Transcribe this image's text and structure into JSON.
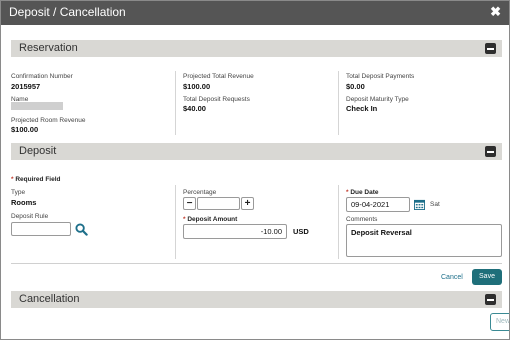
{
  "window": {
    "title": "Deposit / Cancellation",
    "close_glyph": "✖"
  },
  "reservation": {
    "section_title": "Reservation",
    "confirmation_number_label": "Confirmation Number",
    "confirmation_number": "2015957",
    "name_label": "Name",
    "projected_room_revenue_label": "Projected Room Revenue",
    "projected_room_revenue": "$100.00",
    "projected_total_revenue_label": "Projected Total Revenue",
    "projected_total_revenue": "$100.00",
    "total_deposit_requests_label": "Total Deposit Requests",
    "total_deposit_requests": "$40.00",
    "total_deposit_payments_label": "Total Deposit Payments",
    "total_deposit_payments": "$0.00",
    "deposit_maturity_type_label": "Deposit Maturity Type",
    "deposit_maturity_type": "Check In"
  },
  "deposit": {
    "section_title": "Deposit",
    "required_field_label": "Required Field",
    "type_label": "Type",
    "type_value": "Rooms",
    "deposit_rule_label": "Deposit Rule",
    "deposit_rule_value": "",
    "percentage_label": "Percentage",
    "percentage_value": "",
    "minus_glyph": "−",
    "plus_glyph": "+",
    "deposit_amount_label": "Deposit Amount",
    "deposit_amount": "-10.00",
    "currency": "USD",
    "due_date_label": "Due Date",
    "due_date": "09-04-2021",
    "due_day": "Sat",
    "comments_label": "Comments",
    "comments": "Deposit Reversal",
    "cancel_label": "Cancel",
    "save_label": "Save"
  },
  "cancellation": {
    "section_title": "Cancellation",
    "new_label": "New"
  },
  "colors": {
    "titlebar": "#555555",
    "section_bar": "#d9d8d4",
    "primary": "#1f6f7a",
    "link": "#1d6f8a",
    "required": "#c0392b"
  },
  "icons": [
    "close-icon",
    "collapse-icon",
    "search-icon",
    "calendar-icon"
  ]
}
